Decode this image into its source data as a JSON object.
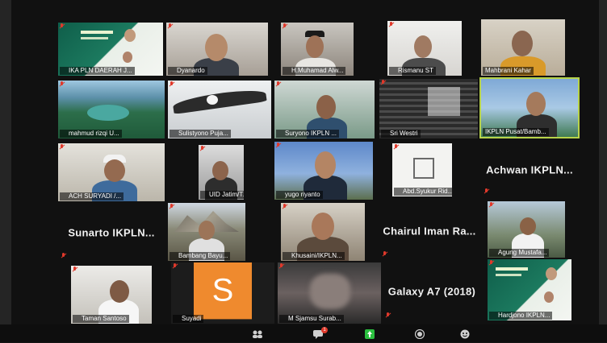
{
  "window": {
    "app": "Zoom Meeting - Gallery View"
  },
  "participants": [
    {
      "name": "IKA PLN DAERAH J...",
      "muted": true,
      "video": "poster"
    },
    {
      "name": "Dyanardo",
      "muted": true,
      "video": "camera"
    },
    {
      "name": "H.Muhamad Alw...",
      "muted": true,
      "video": "camera"
    },
    {
      "name": "Rismanu ST",
      "muted": true,
      "video": "camera"
    },
    {
      "name": "Mahbrani Kahar",
      "muted": false,
      "video": "camera"
    },
    {
      "name": "mahmud rizqi U...",
      "muted": true,
      "video": "landscape"
    },
    {
      "name": "Sulistyono Puja...",
      "muted": true,
      "video": "eagle"
    },
    {
      "name": "Suryono IKPLN ...",
      "muted": true,
      "video": "camera"
    },
    {
      "name": "Sri Westri",
      "muted": true,
      "video": "camera"
    },
    {
      "name": "IKPLN Pusat/Bamb...",
      "muted": false,
      "video": "camera",
      "active_speaker": true
    },
    {
      "name": "ACH SURYADI /...",
      "muted": true,
      "video": "camera"
    },
    {
      "name": "UID Jatim/Talissa...",
      "muted": true,
      "video": "camera"
    },
    {
      "name": "yugo riyanto",
      "muted": true,
      "video": "camera"
    },
    {
      "name": "Abd.Syukur Rid...",
      "muted": true,
      "video": "camera"
    },
    {
      "name": "Achwan IKPLN...",
      "muted": true,
      "video": "off"
    },
    {
      "name": "Sunarto IKPLN...",
      "muted": true,
      "video": "off"
    },
    {
      "name": "Bambang Bayu...",
      "muted": true,
      "video": "camera"
    },
    {
      "name": "Khusaini/IKPLN...",
      "muted": true,
      "video": "camera"
    },
    {
      "name": "Chairul Iman Ra...",
      "muted": true,
      "video": "off"
    },
    {
      "name": "Agung Mustafa...",
      "muted": true,
      "video": "camera"
    },
    {
      "name": "Taman Santoso",
      "muted": true,
      "video": "camera"
    },
    {
      "name": "Suyadi",
      "muted": true,
      "video": "avatar",
      "avatar_letter": "S",
      "avatar_color": "#ef8a2e"
    },
    {
      "name": "M Sjamsu Surab...",
      "muted": true,
      "video": "camera"
    },
    {
      "name": "Galaxy A7 (2018)",
      "muted": true,
      "video": "off"
    },
    {
      "name": "Hardjono IKPLN...",
      "muted": true,
      "video": "poster"
    }
  ],
  "toolbar": {
    "icons": [
      "participants-icon",
      "chat-icon",
      "share-screen-icon",
      "record-icon",
      "reactions-icon"
    ],
    "chat_badge": "1",
    "accent_color": "#2bbf3f"
  },
  "colors": {
    "muted": "#e0392b",
    "active_speaker": "#b7d34a",
    "background": "#111111"
  }
}
